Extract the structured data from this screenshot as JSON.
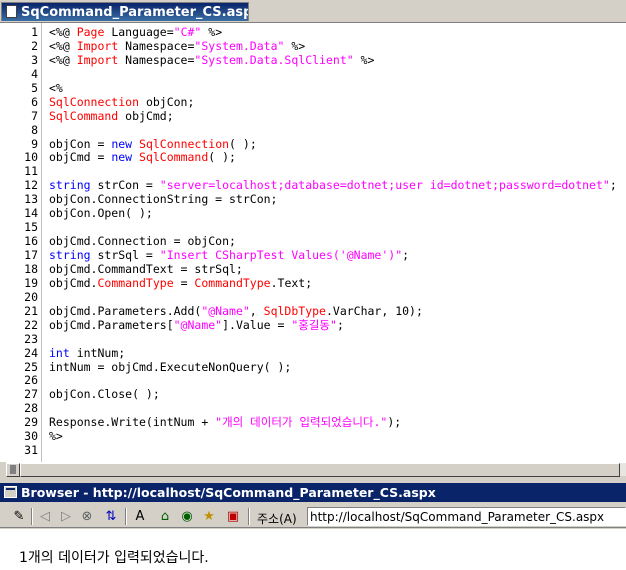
{
  "editor": {
    "tab_title": "SqCommand_Parameter_CS.aspx",
    "lines": [
      {
        "n": "1",
        "parts": [
          [
            "tag",
            "<%@ "
          ],
          [
            "type",
            "Page"
          ],
          [
            "plain",
            " Language="
          ],
          [
            "str",
            "\"C#\""
          ],
          [
            "plain",
            " %>"
          ]
        ]
      },
      {
        "n": "2",
        "parts": [
          [
            "tag",
            "<%@ "
          ],
          [
            "type",
            "Import"
          ],
          [
            "plain",
            " Namespace="
          ],
          [
            "str",
            "\"System.Data\""
          ],
          [
            "plain",
            " %>"
          ]
        ]
      },
      {
        "n": "3",
        "parts": [
          [
            "tag",
            "<%@ "
          ],
          [
            "type",
            "Import"
          ],
          [
            "plain",
            " Namespace="
          ],
          [
            "str",
            "\"System.Data.SqlClient\""
          ],
          [
            "plain",
            " %>"
          ]
        ]
      },
      {
        "n": "4",
        "parts": []
      },
      {
        "n": "5",
        "parts": [
          [
            "plain",
            "<%"
          ]
        ]
      },
      {
        "n": "6",
        "parts": [
          [
            "type",
            "SqlConnection"
          ],
          [
            "plain",
            " objCon;"
          ]
        ]
      },
      {
        "n": "7",
        "parts": [
          [
            "type",
            "SqlCommand"
          ],
          [
            "plain",
            " objCmd;"
          ]
        ]
      },
      {
        "n": "8",
        "parts": []
      },
      {
        "n": "9",
        "parts": [
          [
            "plain",
            "objCon = "
          ],
          [
            "kw",
            "new"
          ],
          [
            "plain",
            " "
          ],
          [
            "type",
            "SqlConnection"
          ],
          [
            "plain",
            "( );"
          ]
        ]
      },
      {
        "n": "10",
        "parts": [
          [
            "plain",
            "objCmd = "
          ],
          [
            "kw",
            "new"
          ],
          [
            "plain",
            " "
          ],
          [
            "type",
            "SqlCommand"
          ],
          [
            "plain",
            "( );"
          ]
        ]
      },
      {
        "n": "11",
        "parts": []
      },
      {
        "n": "12",
        "parts": [
          [
            "kw",
            "string"
          ],
          [
            "plain",
            " strCon = "
          ],
          [
            "str",
            "\"server=localhost;database=dotnet;user id=dotnet;password=dotnet\""
          ],
          [
            "plain",
            ";"
          ]
        ]
      },
      {
        "n": "13",
        "parts": [
          [
            "plain",
            "objCon.ConnectionString = strCon;"
          ]
        ]
      },
      {
        "n": "14",
        "parts": [
          [
            "plain",
            "objCon.Open( );"
          ]
        ]
      },
      {
        "n": "15",
        "parts": []
      },
      {
        "n": "16",
        "parts": [
          [
            "plain",
            "objCmd.Connection = objCon;"
          ]
        ]
      },
      {
        "n": "17",
        "parts": [
          [
            "kw",
            "string"
          ],
          [
            "plain",
            " strSql = "
          ],
          [
            "str",
            "\"Insert CSharpTest Values('@Name')\""
          ],
          [
            "plain",
            ";"
          ]
        ]
      },
      {
        "n": "18",
        "parts": [
          [
            "plain",
            "objCmd.CommandText = strSql;"
          ]
        ]
      },
      {
        "n": "19",
        "parts": [
          [
            "plain",
            "objCmd."
          ],
          [
            "type",
            "CommandType"
          ],
          [
            "plain",
            " = "
          ],
          [
            "type",
            "CommandType"
          ],
          [
            "plain",
            ".Text;"
          ]
        ]
      },
      {
        "n": "20",
        "parts": []
      },
      {
        "n": "21",
        "parts": [
          [
            "plain",
            "objCmd.Parameters.Add("
          ],
          [
            "str",
            "\"@Name\""
          ],
          [
            "plain",
            ", "
          ],
          [
            "type",
            "SqlDbType"
          ],
          [
            "plain",
            ".VarChar, 10);"
          ]
        ]
      },
      {
        "n": "22",
        "parts": [
          [
            "plain",
            "objCmd.Parameters["
          ],
          [
            "str",
            "\"@Name\""
          ],
          [
            "plain",
            "].Value = "
          ],
          [
            "str",
            "\"홍길동\""
          ],
          [
            "plain",
            ";"
          ]
        ]
      },
      {
        "n": "23",
        "parts": []
      },
      {
        "n": "24",
        "parts": [
          [
            "kw",
            "int"
          ],
          [
            "plain",
            " intNum;"
          ]
        ]
      },
      {
        "n": "25",
        "parts": [
          [
            "plain",
            "intNum = objCmd.ExecuteNonQuery( );"
          ]
        ]
      },
      {
        "n": "26",
        "parts": []
      },
      {
        "n": "27",
        "parts": [
          [
            "plain",
            "objCon.Close( );"
          ]
        ]
      },
      {
        "n": "28",
        "parts": []
      },
      {
        "n": "29",
        "parts": [
          [
            "plain",
            "Response.Write(intNum + "
          ],
          [
            "str",
            "\"개의 데이터가 입력되었습니다.\""
          ],
          [
            "plain",
            ");"
          ]
        ]
      },
      {
        "n": "30",
        "parts": [
          [
            "plain",
            "%>"
          ]
        ]
      },
      {
        "n": "31",
        "parts": []
      }
    ]
  },
  "browser": {
    "title": "Browser - http://localhost/SqCommand_Parameter_CS.aspx",
    "address_label": "주소(A)",
    "address_value": "http://localhost/SqCommand_Parameter_CS.aspx",
    "output_text": "1개의 데이터가 입력되었습니다.",
    "toolbar_icons": [
      {
        "name": "edit-pencil-icon",
        "glyph": "✎"
      },
      {
        "name": "back-arrow-icon",
        "glyph": "◁"
      },
      {
        "name": "forward-arrow-icon",
        "glyph": "▷"
      },
      {
        "name": "stop-icon",
        "glyph": "⊗"
      },
      {
        "name": "refresh-icon",
        "glyph": "⇅"
      },
      {
        "name": "font-size-icon",
        "glyph": "A"
      },
      {
        "name": "home-icon",
        "glyph": "⌂"
      },
      {
        "name": "search-globe-icon",
        "glyph": "◉"
      },
      {
        "name": "favorites-icon",
        "glyph": "★"
      },
      {
        "name": "history-icon",
        "glyph": "▣"
      }
    ]
  },
  "colors": {
    "keyword": "#0000ff",
    "type": "#ff0000",
    "string": "#ff00ff",
    "title_bar": "#0a246a"
  }
}
